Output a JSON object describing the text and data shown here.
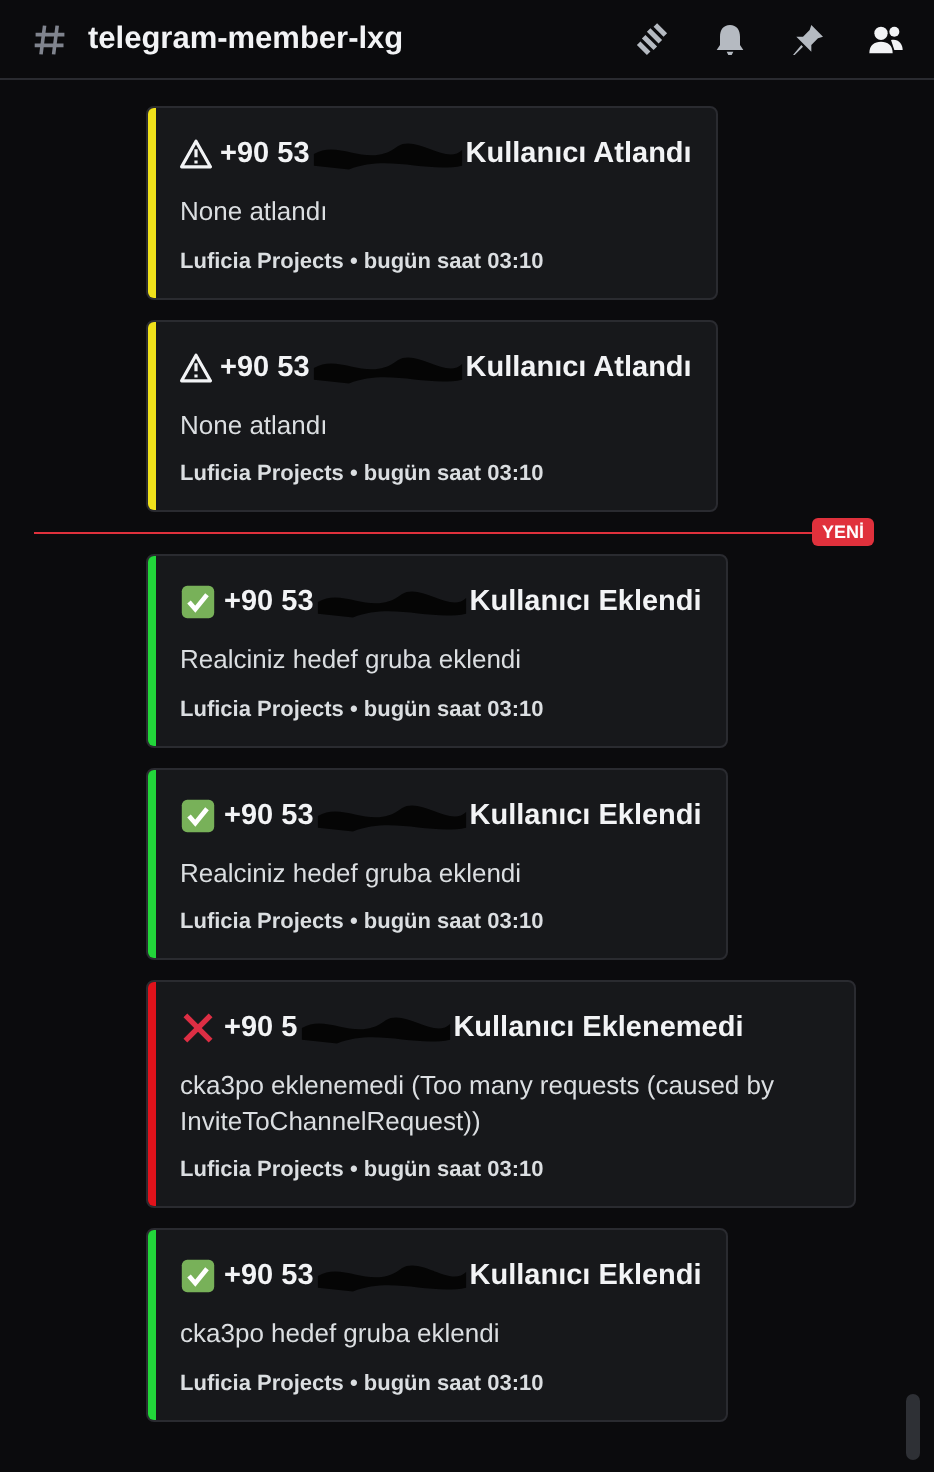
{
  "channel": {
    "name": "telegram-member-lxg"
  },
  "messages": [
    {
      "kind": "warning",
      "color": "#f0e11b",
      "title_prefix": "+90 53",
      "title_suffix": "Kullanıcı Atlandı",
      "body": "None atlandı",
      "footer": "Luficia Projects • bugün saat 03:10"
    },
    {
      "kind": "warning",
      "color": "#f0e11b",
      "title_prefix": "+90 53",
      "title_suffix": "Kullanıcı Atlandı",
      "body": "None atlandı",
      "footer": "Luficia Projects • bugün saat 03:10"
    },
    {
      "kind": "divider",
      "label": "YENİ"
    },
    {
      "kind": "success",
      "color": "#22d63a",
      "title_prefix": "+90 53",
      "title_suffix": "Kullanıcı Eklendi",
      "body": "Realciniz hedef gruba eklendi",
      "footer": "Luficia Projects • bugün saat 03:10"
    },
    {
      "kind": "success",
      "color": "#22d63a",
      "title_prefix": "+90 53",
      "title_suffix": "Kullanıcı Eklendi",
      "body": "Realciniz hedef gruba eklendi",
      "footer": "Luficia Projects • bugün saat 03:10"
    },
    {
      "kind": "error",
      "color": "#e0121b",
      "title_prefix": "+90 5",
      "title_suffix": "Kullanıcı Eklenemedi",
      "body": "cka3po eklenemedi (Too many requests (caused by InviteToChannelRequest))",
      "footer": "Luficia Projects • bugün saat 03:10"
    },
    {
      "kind": "success",
      "color": "#22d63a",
      "title_prefix": "+90 53",
      "title_suffix": "Kullanıcı Eklendi",
      "body": "cka3po hedef gruba eklendi",
      "footer": "Luficia Projects • bugün saat 03:10"
    }
  ]
}
